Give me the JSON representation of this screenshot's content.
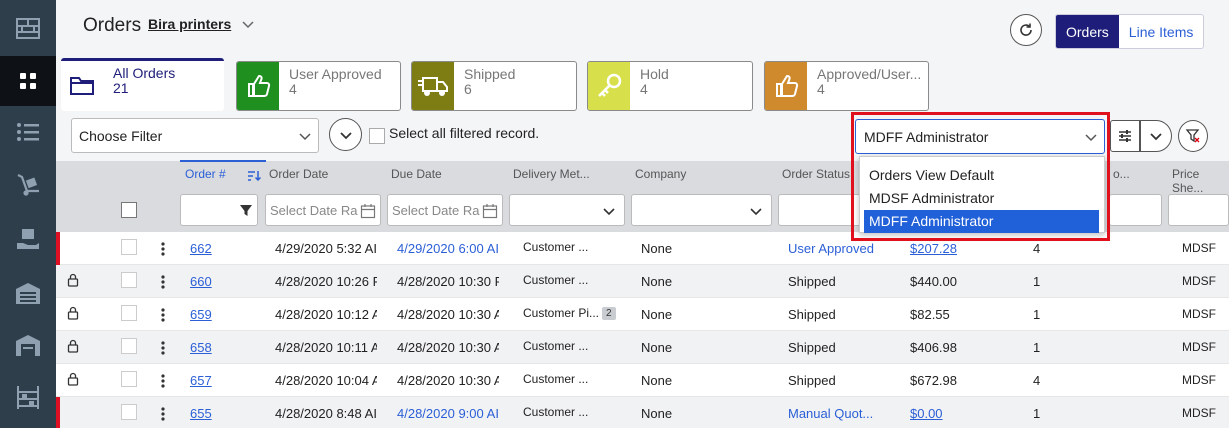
{
  "header": {
    "title": "Orders",
    "company": "Bira printers",
    "view_toggle": {
      "orders": "Orders",
      "line_items": "Line Items"
    }
  },
  "status_tabs": [
    {
      "label": "All Orders",
      "count": "21",
      "icon": "folder-icon",
      "color": "#ffffff"
    },
    {
      "label": "User Approved",
      "count": "4",
      "icon": "thumbs-up-icon",
      "color": "#1f8f1f"
    },
    {
      "label": "Shipped",
      "count": "6",
      "icon": "truck-icon",
      "color": "#7d7d14"
    },
    {
      "label": "Hold",
      "count": "4",
      "icon": "key-icon",
      "color": "#d7e04a"
    },
    {
      "label": "Approved/User...",
      "count": "4",
      "icon": "thumbs-up-icon",
      "color": "#cf8a2e"
    }
  ],
  "toolbar": {
    "filter_placeholder": "Choose Filter",
    "select_all_label": "Select all filtered record.",
    "view_selected": "MDFF Administrator"
  },
  "view_dropdown": {
    "options": [
      "Orders View Default",
      "MDSF Administrator",
      "MDFF Administrator"
    ],
    "selected_index": 2
  },
  "columns": {
    "order_no": "Order #",
    "order_date": "Order Date",
    "due_date": "Due Date",
    "delivery": "Delivery Met...",
    "company": "Company",
    "status": "Order Status",
    "o": "o...",
    "price_sheet": "Price She..."
  },
  "column_filters": {
    "order_date_placeholder": "Select Date Ra",
    "due_date_placeholder": "Select Date Ra"
  },
  "rows": [
    {
      "order": "662",
      "order_date": "4/29/2020 5:32 AI",
      "due_date": "4/29/2020 6:00 AI",
      "due_blue": true,
      "delivery": "Customer ...",
      "badge": "",
      "company": "None",
      "status": "User Approved",
      "status_blue": true,
      "total": "$207.28",
      "total_link": true,
      "qty": "4",
      "price_sheet": "MDSF",
      "locked": false,
      "flag": true
    },
    {
      "order": "660",
      "order_date": "4/28/2020 10:26 F",
      "due_date": "4/28/2020 10:30 F",
      "due_blue": false,
      "delivery": "Customer ...",
      "badge": "",
      "company": "None",
      "status": "Shipped",
      "status_blue": false,
      "total": "$440.00",
      "total_link": false,
      "qty": "1",
      "price_sheet": "MDSF",
      "locked": true,
      "flag": false
    },
    {
      "order": "659",
      "order_date": "4/28/2020 10:12 A",
      "due_date": "4/28/2020 10:30 A",
      "due_blue": false,
      "delivery": "Customer Pi...",
      "badge": "2",
      "company": "None",
      "status": "Shipped",
      "status_blue": false,
      "total": "$82.55",
      "total_link": false,
      "qty": "1",
      "price_sheet": "MDSF",
      "locked": true,
      "flag": false
    },
    {
      "order": "658",
      "order_date": "4/28/2020 10:11 A",
      "due_date": "4/28/2020 10:30 A",
      "due_blue": false,
      "delivery": "Customer ...",
      "badge": "",
      "company": "None",
      "status": "Shipped",
      "status_blue": false,
      "total": "$406.98",
      "total_link": false,
      "qty": "1",
      "price_sheet": "MDSF",
      "locked": true,
      "flag": false
    },
    {
      "order": "657",
      "order_date": "4/28/2020 10:04 A",
      "due_date": "4/28/2020 10:30 A",
      "due_blue": false,
      "delivery": "Customer ...",
      "badge": "",
      "company": "None",
      "status": "Shipped",
      "status_blue": false,
      "total": "$672.98",
      "total_link": false,
      "qty": "4",
      "price_sheet": "MDSF",
      "locked": true,
      "flag": false
    },
    {
      "order": "655",
      "order_date": "4/28/2020 8:48 AI",
      "due_date": "4/28/2020 9:00 AI",
      "due_blue": true,
      "delivery": "Customer ...",
      "badge": "",
      "company": "None",
      "status": "Manual Quot...",
      "status_blue": true,
      "total": "$0.00",
      "total_link": true,
      "qty": "1",
      "price_sheet": "MDSF",
      "locked": false,
      "flag": true
    }
  ]
}
